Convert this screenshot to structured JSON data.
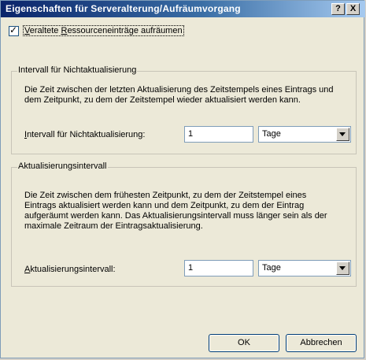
{
  "window": {
    "title": "Eigenschaften für Serveralterung/Aufräumvorgang",
    "help_label": "?",
    "close_label": "X"
  },
  "scavenge": {
    "checked": true,
    "check_mark": "✓",
    "label_prefix": "",
    "label_accel": "V",
    "label_rest": "eraltete ",
    "label_accel2": "R",
    "label_rest2": "essourceneinträge aufräumen"
  },
  "no_refresh_group": {
    "title": "Intervall für Nichtaktualisierung",
    "description": "Die Zeit zwischen der letzten Aktualisierung des Zeitstempels eines Eintrags und dem Zeitpunkt, zu dem der Zeitstempel wieder aktualisiert werden kann.",
    "field_accel": "I",
    "field_rest": "ntervall für Nichtaktualisierung:",
    "value": "1",
    "unit": "Tage"
  },
  "refresh_group": {
    "title": "Aktualisierungsintervall",
    "description": "Die Zeit zwischen dem frühesten Zeitpunkt, zu dem der Zeitstempel eines Eintrags aktualisiert werden kann und dem Zeitpunkt, zu dem der Eintrag aufgeräumt werden kann. Das Aktualisierungsintervall muss länger sein als der maximale Zeitraum der Eintragsaktualisierung.",
    "field_accel": "A",
    "field_rest": "ktualisierungsintervall:",
    "value": "1",
    "unit": "Tage"
  },
  "buttons": {
    "ok": "OK",
    "cancel": "Abbrechen"
  }
}
